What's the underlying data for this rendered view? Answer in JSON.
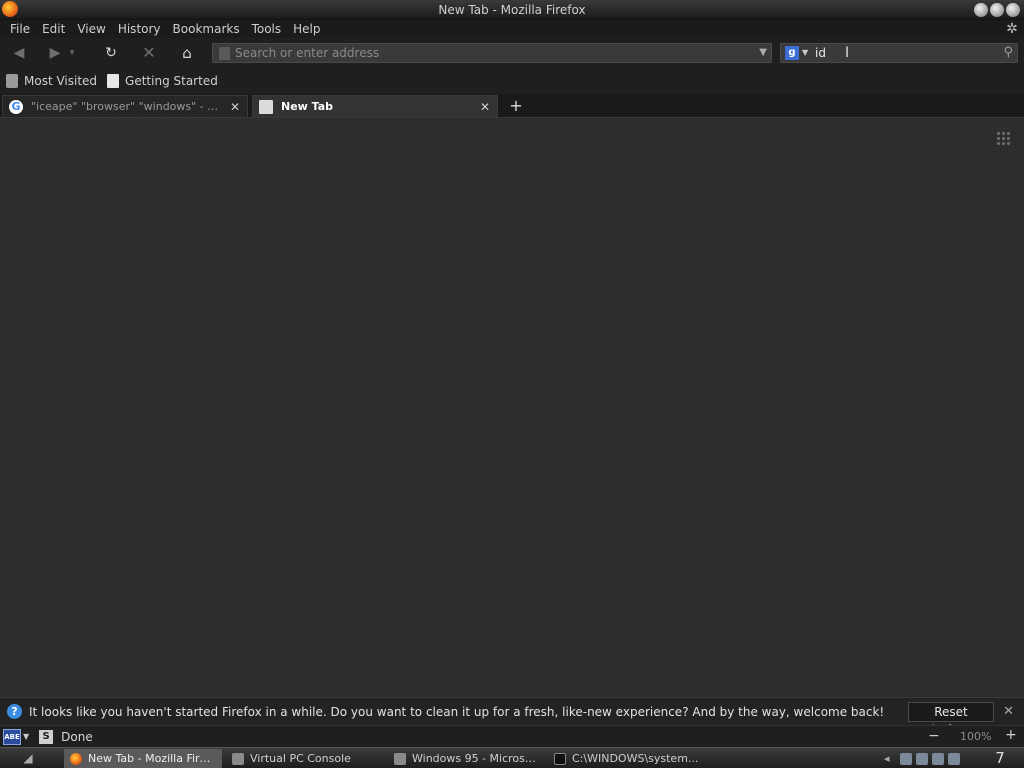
{
  "window": {
    "title": "New Tab - Mozilla Firefox"
  },
  "menu": {
    "items": [
      {
        "label": "File"
      },
      {
        "label": "Edit"
      },
      {
        "label": "View"
      },
      {
        "label": "History"
      },
      {
        "label": "Bookmarks"
      },
      {
        "label": "Tools"
      },
      {
        "label": "Help"
      }
    ]
  },
  "nav": {
    "back_icon": "back-arrow-icon",
    "forward_icon": "forward-arrow-icon",
    "reload_icon": "reload-icon",
    "stop_icon": "stop-icon",
    "home_icon": "home-icon"
  },
  "urlbar": {
    "placeholder": "Search or enter address",
    "value": ""
  },
  "searchbar": {
    "engine": "g",
    "value": "id"
  },
  "bookmarks": {
    "items": [
      {
        "label": "Most Visited",
        "icon": "most-visited-icon"
      },
      {
        "label": "Getting Started",
        "icon": "page-icon"
      }
    ]
  },
  "tabs": [
    {
      "label": "\"iceape\" \"browser\" \"windows\" - Goo...",
      "favicon": "google-g-icon",
      "active": false
    },
    {
      "label": "New Tab",
      "favicon": "page-icon",
      "active": true
    }
  ],
  "notification": {
    "message": "It looks like you haven't started Firefox in a while. Do you want to clean it up for a fresh, like-new experience? And by the way, welcome back!",
    "button": "Reset Firefox..."
  },
  "statusbar": {
    "abe": "ABE",
    "s_label": "S",
    "status": "Done",
    "zoom": "100%"
  },
  "taskbar": {
    "tasks": [
      {
        "label": "New Tab - Mozilla Firefox",
        "active": true
      },
      {
        "label": "Virtual PC Console",
        "active": false
      },
      {
        "label": "Windows 95 - Microsof...",
        "active": false
      },
      {
        "label": "C:\\WINDOWS\\system...",
        "active": false
      }
    ],
    "clock": "7"
  },
  "colors": {
    "accent": "#3a8de0",
    "background": "#2b2b2b",
    "toolbar": "#1f1f1f"
  }
}
